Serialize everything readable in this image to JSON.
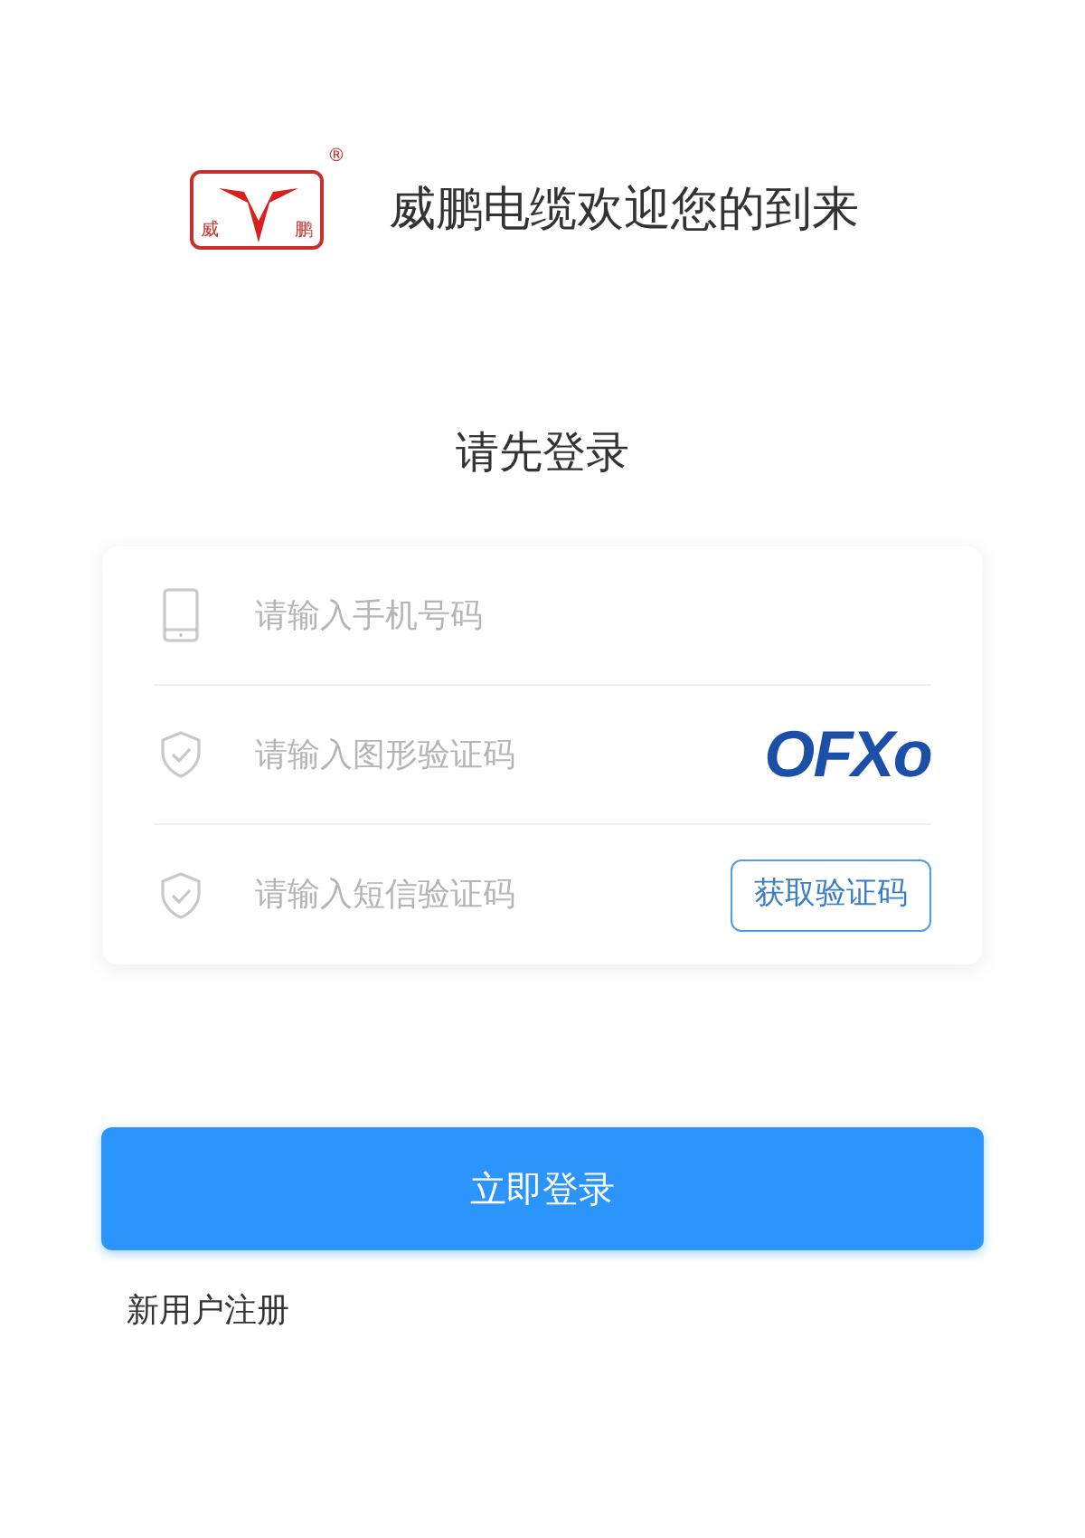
{
  "header": {
    "logo_chars": [
      "威",
      "鹏"
    ],
    "logo_mark": "®",
    "welcome": "威鹏电缆欢迎您的到来"
  },
  "heading": "请先登录",
  "fields": [
    {
      "kind": "phone",
      "placeholder": "请输入手机号码"
    },
    {
      "kind": "captcha",
      "placeholder": "请输入图形验证码",
      "captcha": "OFXo"
    },
    {
      "kind": "sms",
      "placeholder": "请输入短信验证码",
      "button": "获取验证码"
    }
  ],
  "login_button": "立即登录",
  "register_link": "新用户注册"
}
